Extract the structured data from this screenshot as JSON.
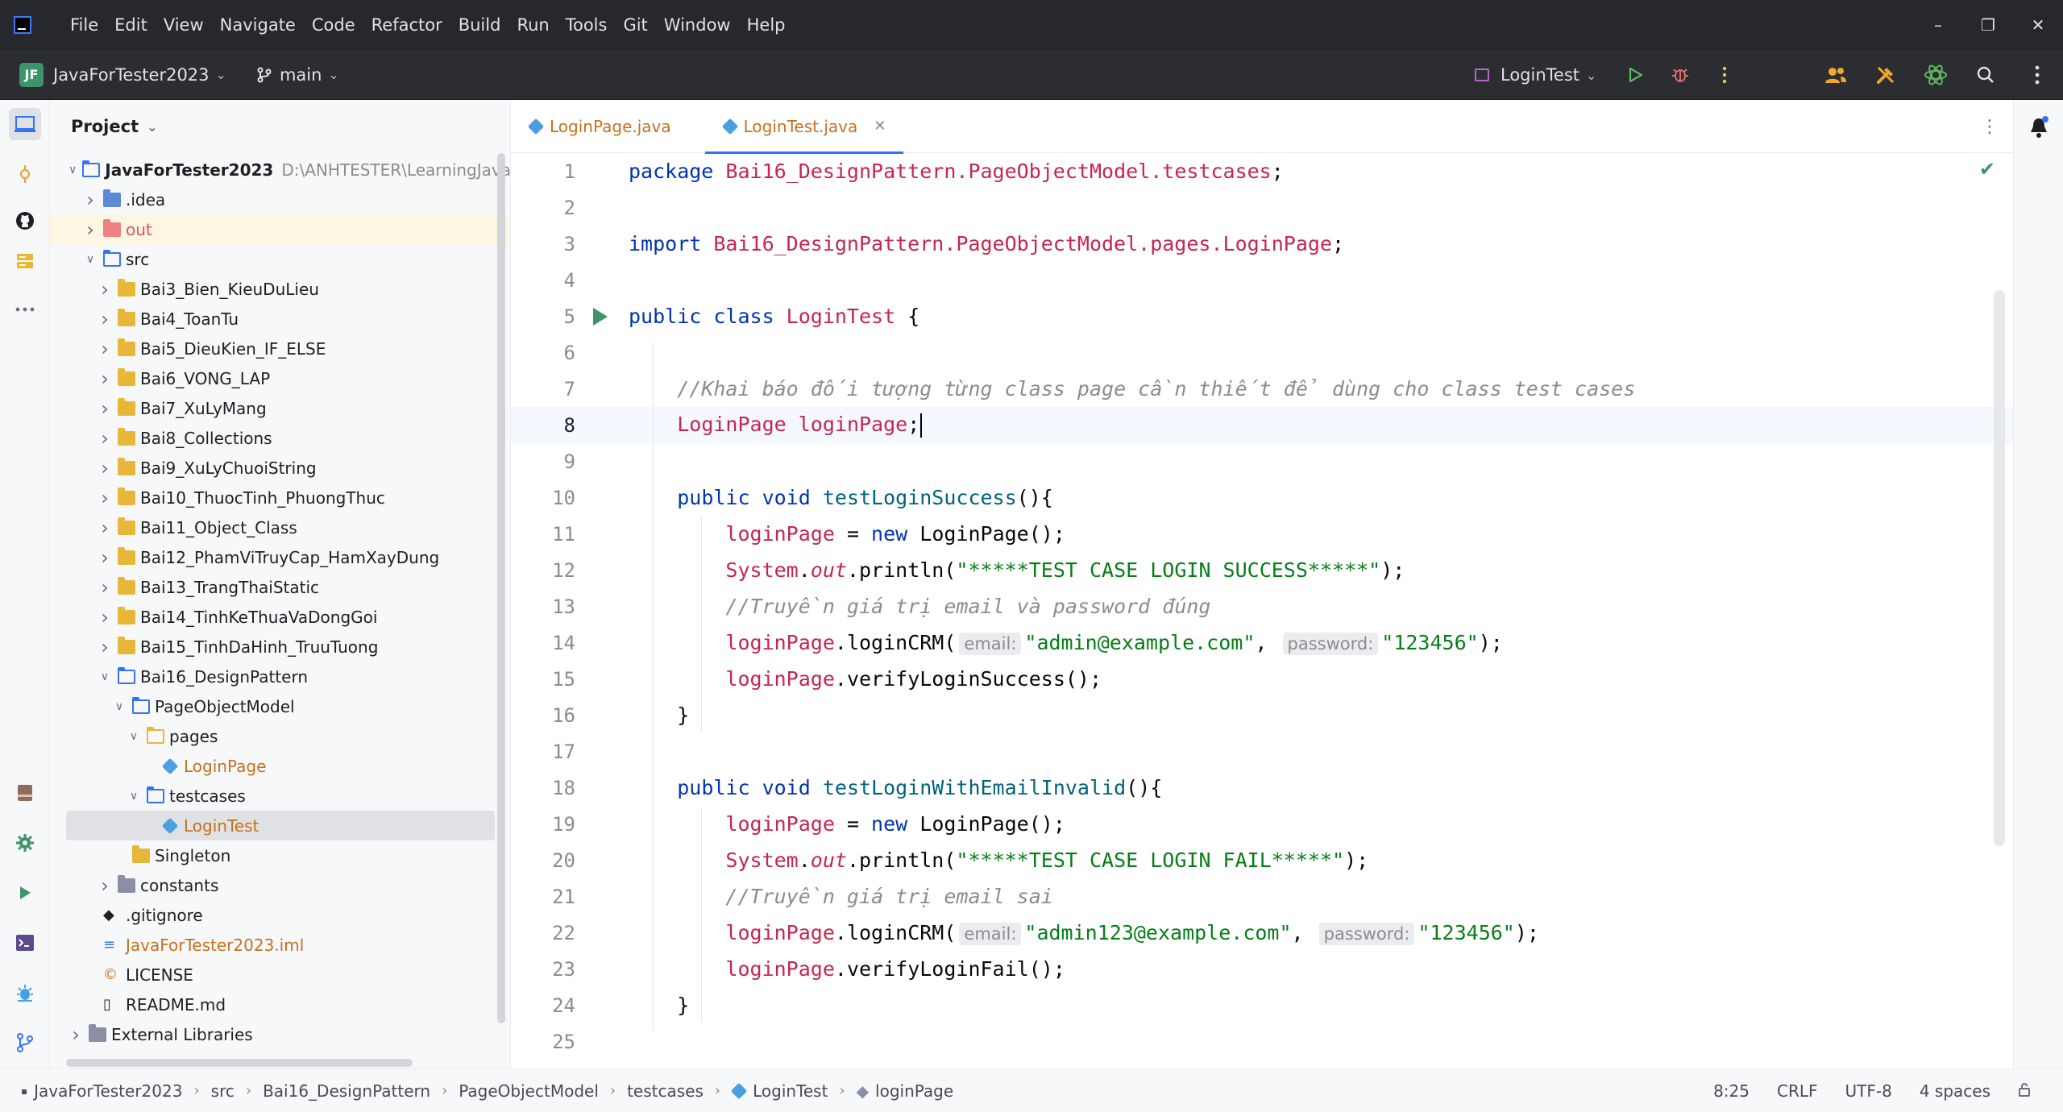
{
  "menu": [
    "File",
    "Edit",
    "View",
    "Navigate",
    "Code",
    "Refactor",
    "Build",
    "Run",
    "Tools",
    "Git",
    "Window",
    "Help"
  ],
  "toolbar": {
    "project_badge": "JF",
    "project_name": "JavaForTester2023",
    "branch": "main",
    "run_config": "LoginTest"
  },
  "project_panel": {
    "title": "Project",
    "tree": [
      {
        "label": "JavaForTester2023",
        "hint": "D:\\ANHTESTER\\LearningJava",
        "depth": 0,
        "arrow": "open",
        "icon": "module"
      },
      {
        "label": ".idea",
        "depth": 1,
        "arrow": "closed",
        "icon": "idea"
      },
      {
        "label": "out",
        "depth": 1,
        "arrow": "closed",
        "icon": "out"
      },
      {
        "label": "src",
        "depth": 1,
        "arrow": "open",
        "icon": "src"
      },
      {
        "label": "Bai3_Bien_KieuDuLieu",
        "depth": 2,
        "arrow": "closed",
        "icon": "package"
      },
      {
        "label": "Bai4_ToanTu",
        "depth": 2,
        "arrow": "closed",
        "icon": "package"
      },
      {
        "label": "Bai5_DieuKien_IF_ELSE",
        "depth": 2,
        "arrow": "closed",
        "icon": "package"
      },
      {
        "label": "Bai6_VONG_LAP",
        "depth": 2,
        "arrow": "closed",
        "icon": "package"
      },
      {
        "label": "Bai7_XuLyMang",
        "depth": 2,
        "arrow": "closed",
        "icon": "package"
      },
      {
        "label": "Bai8_Collections",
        "depth": 2,
        "arrow": "closed",
        "icon": "package"
      },
      {
        "label": "Bai9_XuLyChuoiString",
        "depth": 2,
        "arrow": "closed",
        "icon": "package"
      },
      {
        "label": "Bai10_ThuocTinh_PhuongThuc",
        "depth": 2,
        "arrow": "closed",
        "icon": "package"
      },
      {
        "label": "Bai11_Object_Class",
        "depth": 2,
        "arrow": "closed",
        "icon": "package"
      },
      {
        "label": "Bai12_PhamViTruyCap_HamXayDung",
        "depth": 2,
        "arrow": "closed",
        "icon": "package"
      },
      {
        "label": "Bai13_TrangThaiStatic",
        "depth": 2,
        "arrow": "closed",
        "icon": "package"
      },
      {
        "label": "Bai14_TinhKeThuaVaDongGoi",
        "depth": 2,
        "arrow": "closed",
        "icon": "package"
      },
      {
        "label": "Bai15_TinhDaHinh_TruuTuong",
        "depth": 2,
        "arrow": "closed",
        "icon": "package"
      },
      {
        "label": "Bai16_DesignPattern",
        "depth": 2,
        "arrow": "open",
        "icon": "package-open"
      },
      {
        "label": "PageObjectModel",
        "depth": 3,
        "arrow": "open",
        "icon": "package-open"
      },
      {
        "label": "pages",
        "depth": 4,
        "arrow": "open",
        "icon": "package-open-y"
      },
      {
        "label": "LoginPage",
        "depth": 5,
        "arrow": "none",
        "icon": "class"
      },
      {
        "label": "testcases",
        "depth": 4,
        "arrow": "open",
        "icon": "package-open"
      },
      {
        "label": "LoginTest",
        "depth": 5,
        "arrow": "none",
        "icon": "class",
        "selected": true
      },
      {
        "label": "Singleton",
        "depth": 3,
        "arrow": "none",
        "icon": "package"
      },
      {
        "label": "constants",
        "depth": 2,
        "arrow": "closed",
        "icon": "constants"
      },
      {
        "label": ".gitignore",
        "depth": 1,
        "arrow": "none",
        "icon": "gitignore"
      },
      {
        "label": "JavaForTester2023.iml",
        "depth": 1,
        "arrow": "none",
        "icon": "iml"
      },
      {
        "label": "LICENSE",
        "depth": 1,
        "arrow": "none",
        "icon": "license"
      },
      {
        "label": "README.md",
        "depth": 1,
        "arrow": "none",
        "icon": "md"
      },
      {
        "label": "External Libraries",
        "depth": 0,
        "arrow": "closed",
        "icon": "lib"
      }
    ]
  },
  "tabs": [
    {
      "label": "LoginPage.java",
      "active": false
    },
    {
      "label": "LoginTest.java",
      "active": true
    }
  ],
  "code_lines": [
    {
      "n": "1",
      "parts": [
        [
          "kw",
          "package "
        ],
        [
          "pkg",
          "Bai16_DesignPattern.PageObjectModel.testcases"
        ],
        [
          "plain",
          ";"
        ]
      ]
    },
    {
      "n": "2",
      "parts": []
    },
    {
      "n": "3",
      "parts": [
        [
          "kw",
          "import "
        ],
        [
          "pkg",
          "Bai16_DesignPattern.PageObjectModel.pages.LoginPage"
        ],
        [
          "plain",
          ";"
        ]
      ]
    },
    {
      "n": "4",
      "parts": []
    },
    {
      "n": "5",
      "parts": [
        [
          "kw",
          "public class "
        ],
        [
          "cls",
          "LoginTest"
        ],
        [
          "plain",
          " {"
        ]
      ],
      "run": true
    },
    {
      "n": "6",
      "parts": []
    },
    {
      "n": "7",
      "parts": [
        [
          "plain",
          "    "
        ],
        [
          "cmt",
          "//Khai báo đối tượng từng class page cần thiết để dùng cho class test cases"
        ]
      ]
    },
    {
      "n": "8",
      "parts": [
        [
          "plain",
          "    "
        ],
        [
          "cls",
          "LoginPage"
        ],
        [
          "plain",
          " "
        ],
        [
          "fld",
          "loginPage"
        ],
        [
          "plain",
          ";"
        ],
        [
          "caret",
          ""
        ]
      ],
      "current": true
    },
    {
      "n": "9",
      "parts": []
    },
    {
      "n": "10",
      "parts": [
        [
          "plain",
          "    "
        ],
        [
          "kw",
          "public void "
        ],
        [
          "mth",
          "testLoginSuccess"
        ],
        [
          "plain",
          "(){"
        ]
      ]
    },
    {
      "n": "11",
      "parts": [
        [
          "plain",
          "        "
        ],
        [
          "fld",
          "loginPage"
        ],
        [
          "plain",
          " = "
        ],
        [
          "kw",
          "new "
        ],
        [
          "plain",
          "LoginPage();"
        ]
      ]
    },
    {
      "n": "12",
      "parts": [
        [
          "plain",
          "        "
        ],
        [
          "cls",
          "System"
        ],
        [
          "plain",
          "."
        ],
        [
          "ital-fld",
          "out"
        ],
        [
          "plain",
          ".println("
        ],
        [
          "str",
          "\"*****TEST CASE LOGIN SUCCESS*****\""
        ],
        [
          "plain",
          ");"
        ]
      ]
    },
    {
      "n": "13",
      "parts": [
        [
          "plain",
          "        "
        ],
        [
          "cmt",
          "//Truyền giá trị email và password đúng"
        ]
      ]
    },
    {
      "n": "14",
      "parts": [
        [
          "plain",
          "        "
        ],
        [
          "fld",
          "loginPage"
        ],
        [
          "plain",
          ".loginCRM("
        ],
        [
          "hint",
          "email:"
        ],
        [
          "str",
          "\"admin@example.com\""
        ],
        [
          "plain",
          ", "
        ],
        [
          "hint",
          "password:"
        ],
        [
          "str",
          "\"123456\""
        ],
        [
          "plain",
          ");"
        ]
      ]
    },
    {
      "n": "15",
      "parts": [
        [
          "plain",
          "        "
        ],
        [
          "fld",
          "loginPage"
        ],
        [
          "plain",
          ".verifyLoginSuccess();"
        ]
      ]
    },
    {
      "n": "16",
      "parts": [
        [
          "plain",
          "    }"
        ]
      ]
    },
    {
      "n": "17",
      "parts": []
    },
    {
      "n": "18",
      "parts": [
        [
          "plain",
          "    "
        ],
        [
          "kw",
          "public void "
        ],
        [
          "mth",
          "testLoginWithEmailInvalid"
        ],
        [
          "plain",
          "(){"
        ]
      ]
    },
    {
      "n": "19",
      "parts": [
        [
          "plain",
          "        "
        ],
        [
          "fld",
          "loginPage"
        ],
        [
          "plain",
          " = "
        ],
        [
          "kw",
          "new "
        ],
        [
          "plain",
          "LoginPage();"
        ]
      ]
    },
    {
      "n": "20",
      "parts": [
        [
          "plain",
          "        "
        ],
        [
          "cls",
          "System"
        ],
        [
          "plain",
          "."
        ],
        [
          "ital-fld",
          "out"
        ],
        [
          "plain",
          ".println("
        ],
        [
          "str",
          "\"*****TEST CASE LOGIN FAIL*****\""
        ],
        [
          "plain",
          ");"
        ]
      ]
    },
    {
      "n": "21",
      "parts": [
        [
          "plain",
          "        "
        ],
        [
          "cmt",
          "//Truyền giá trị email sai"
        ]
      ]
    },
    {
      "n": "22",
      "parts": [
        [
          "plain",
          "        "
        ],
        [
          "fld",
          "loginPage"
        ],
        [
          "plain",
          ".loginCRM("
        ],
        [
          "hint",
          "email:"
        ],
        [
          "str",
          "\"admin123@example.com\""
        ],
        [
          "plain",
          ", "
        ],
        [
          "hint",
          "password:"
        ],
        [
          "str",
          "\"123456\""
        ],
        [
          "plain",
          ");"
        ]
      ]
    },
    {
      "n": "23",
      "parts": [
        [
          "plain",
          "        "
        ],
        [
          "fld",
          "loginPage"
        ],
        [
          "plain",
          ".verifyLoginFail();"
        ]
      ]
    },
    {
      "n": "24",
      "parts": [
        [
          "plain",
          "    }"
        ]
      ]
    },
    {
      "n": "25",
      "parts": []
    }
  ],
  "statusbar": {
    "breadcrumbs": [
      "JavaForTester2023",
      "src",
      "Bai16_DesignPattern",
      "PageObjectModel",
      "testcases",
      "LoginTest",
      "loginPage"
    ],
    "position": "8:25",
    "line_ending": "CRLF",
    "encoding": "UTF-8",
    "indent": "4 spaces"
  }
}
